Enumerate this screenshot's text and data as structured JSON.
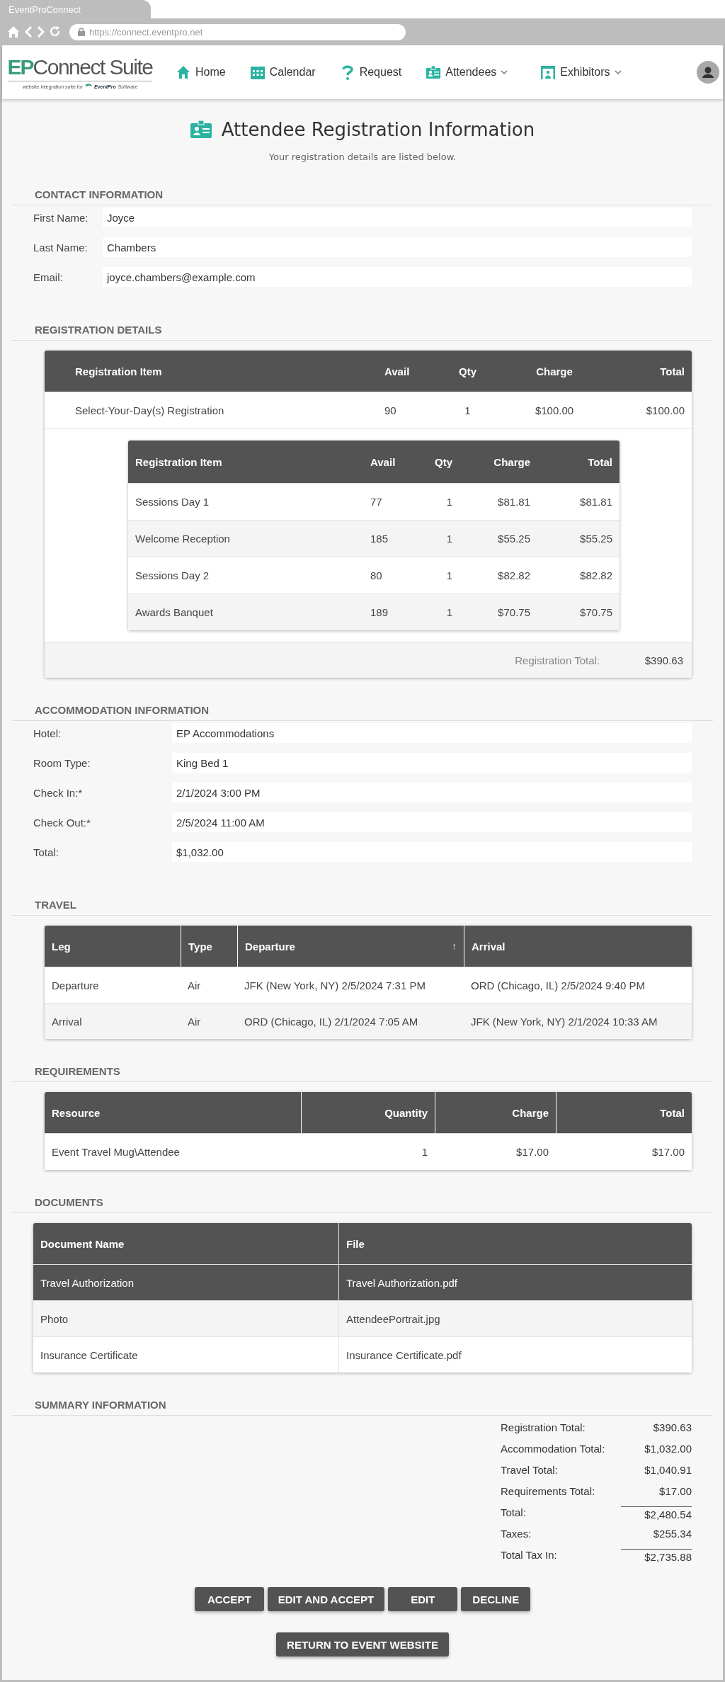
{
  "browser": {
    "tab_title": "EventProConnect",
    "url": "https://connect.eventpro.net"
  },
  "logo": {
    "mark": "EP",
    "name": "Connect Suite",
    "tagline": "website integration suite for",
    "brand": "EventPro",
    "brand_suffix": "Software"
  },
  "nav": [
    {
      "label": "Home",
      "kind": "home",
      "dropdown": false
    },
    {
      "label": "Calendar",
      "kind": "calendar",
      "dropdown": false
    },
    {
      "label": "Request",
      "kind": "help",
      "dropdown": false
    },
    {
      "label": "Attendees",
      "kind": "attendees",
      "dropdown": true
    },
    {
      "label": "Exhibitors",
      "kind": "exhibitors",
      "dropdown": true
    }
  ],
  "page": {
    "title": "Attendee Registration Information",
    "subtitle": "Your registration details are listed below."
  },
  "contact": {
    "heading": "CONTACT INFORMATION",
    "fields": [
      {
        "label": "First Name:",
        "value": "Joyce"
      },
      {
        "label": "Last Name:",
        "value": "Chambers"
      },
      {
        "label": "Email:",
        "value": "joyce.chambers@example.com"
      }
    ]
  },
  "registration": {
    "heading": "REGISTRATION DETAILS",
    "columns": [
      "Registration Item",
      "Avail",
      "Qty",
      "Charge",
      "Total"
    ],
    "rows": [
      {
        "cells": [
          "Select-Your-Day(s) Registration",
          "90",
          "1",
          "$100.00",
          "$100.00"
        ],
        "children": [
          {
            "cells": [
              "Sessions Day 1",
              "77",
              "1",
              "$81.81",
              "$81.81"
            ]
          },
          {
            "cells": [
              "Welcome Reception",
              "185",
              "1",
              "$55.25",
              "$55.25"
            ]
          },
          {
            "cells": [
              "Sessions Day 2",
              "80",
              "1",
              "$82.82",
              "$82.82"
            ]
          },
          {
            "cells": [
              "Awards Banquet",
              "189",
              "1",
              "$70.75",
              "$70.75"
            ]
          }
        ]
      }
    ],
    "child_columns": [
      "Registration Item",
      "Avail",
      "Qty",
      "Charge",
      "Total"
    ],
    "total_label": "Registration Total:",
    "total": "$390.63"
  },
  "accommodation": {
    "heading": "ACCOMMODATION INFORMATION",
    "fields": [
      {
        "label": "Hotel:",
        "value": "EP Accommodations"
      },
      {
        "label": "Room Type:",
        "value": "King Bed 1"
      },
      {
        "label": "Check In:*",
        "value": "2/1/2024 3:00 PM"
      },
      {
        "label": "Check Out:*",
        "value": "2/5/2024 11:00 AM"
      },
      {
        "label": "Total:",
        "value": "$1,032.00"
      }
    ]
  },
  "travel": {
    "heading": "TRAVEL",
    "columns": [
      {
        "label": "Leg"
      },
      {
        "label": "Type"
      },
      {
        "label": "Departure",
        "sort_indicator": "↑"
      },
      {
        "label": "Arrival"
      }
    ],
    "rows": [
      [
        "Departure",
        "Air",
        "JFK (New York, NY) 2/5/2024 7:31 PM",
        "ORD (Chicago, IL) 2/5/2024 9:40 PM"
      ],
      [
        "Arrival",
        "Air",
        "ORD (Chicago, IL) 2/1/2024 7:05 AM",
        "JFK (New York, NY) 2/1/2024 10:33 AM"
      ]
    ]
  },
  "requirements": {
    "heading": "REQUIREMENTS",
    "columns": [
      "Resource",
      "Quantity",
      "Charge",
      "Total"
    ],
    "rows": [
      [
        "Event Travel Mug\\Attendee",
        "1",
        "$17.00",
        "$17.00"
      ]
    ]
  },
  "documents": {
    "heading": "DOCUMENTS",
    "columns": [
      "Document Name",
      "File"
    ],
    "rows": [
      {
        "cells": [
          "Travel Authorization",
          "Travel Authorization.pdf"
        ],
        "selected": true
      },
      {
        "cells": [
          "Photo",
          "AttendeePortrait.jpg"
        ],
        "selected": false
      },
      {
        "cells": [
          "Insurance Certificate",
          "Insurance Certificate.pdf"
        ],
        "selected": false
      }
    ]
  },
  "summary": {
    "heading": "SUMMARY INFORMATION",
    "rows": [
      {
        "label": "Registration Total:",
        "value": "$390.63",
        "ruled": false
      },
      {
        "label": "Accommodation Total:",
        "value": "$1,032.00",
        "ruled": false
      },
      {
        "label": "Travel Total:",
        "value": "$1,040.91",
        "ruled": false
      },
      {
        "label": "Requirements Total:",
        "value": "$17.00",
        "ruled": false
      },
      {
        "label": "Total:",
        "value": "$2,480.54",
        "ruled": true
      },
      {
        "label": "Taxes:",
        "value": "$255.34",
        "ruled": false
      },
      {
        "label": "Total Tax In:",
        "value": "$2,735.88",
        "ruled": true
      }
    ]
  },
  "actions": [
    "ACCEPT",
    "EDIT AND ACCEPT",
    "EDIT",
    "DECLINE"
  ],
  "return_button": "RETURN TO EVENT WEBSITE"
}
